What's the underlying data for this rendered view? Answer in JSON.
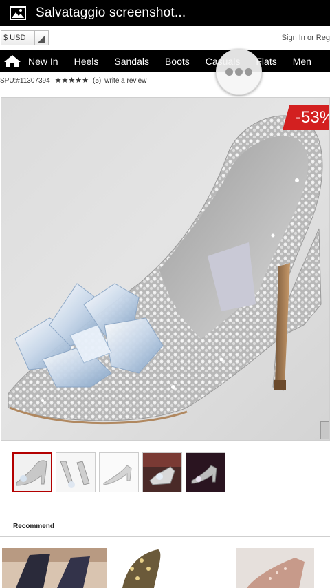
{
  "status_bar": {
    "title": "Salvataggio screenshot...",
    "icon": "image-icon"
  },
  "header": {
    "currency": "$ USD",
    "sign_in_text": "Sign In or Reg"
  },
  "nav": {
    "home_icon": "home-icon",
    "items": [
      {
        "label": "New In"
      },
      {
        "label": "Heels"
      },
      {
        "label": "Sandals"
      },
      {
        "label": "Boots"
      },
      {
        "label": "Casuals"
      },
      {
        "label": "Flats"
      },
      {
        "label": "Men"
      }
    ]
  },
  "overlay": {
    "icon": "more-dots-icon"
  },
  "product": {
    "spu": "SPU:#11307394",
    "rating_stars": 5,
    "review_count": "(5)",
    "review_link": "write a review",
    "discount": "-53%",
    "image": "crystal-stiletto-shoe",
    "thumbnails": [
      "thumb-1",
      "thumb-2",
      "thumb-3",
      "thumb-4",
      "thumb-5"
    ],
    "active_thumbnail": 0
  },
  "recommend": {
    "label": "Recommend"
  },
  "colors": {
    "nav_bg": "#000000",
    "discount_bg": "#d32020",
    "active_thumb_border": "#b30000"
  }
}
